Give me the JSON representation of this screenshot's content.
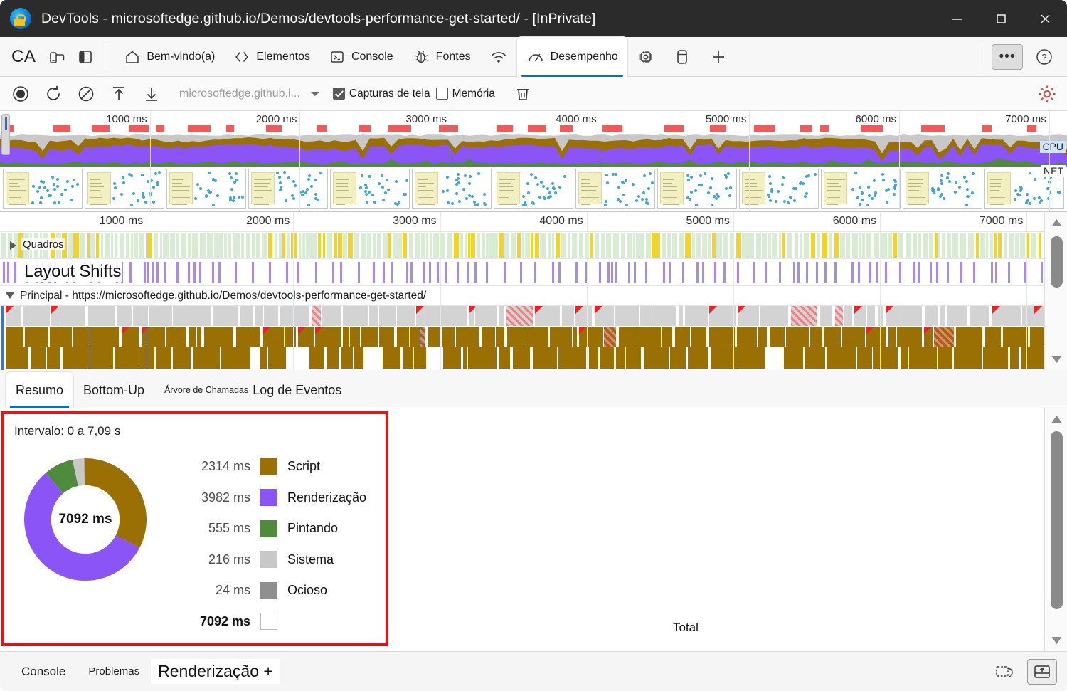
{
  "window": {
    "title": "DevTools - microsoftedge.github.io/Demos/devtools-performance-get-started/ - [InPrivate]",
    "minimize_label": "—",
    "maximize_label": "☐",
    "close_label": "✕"
  },
  "tabstrip": {
    "profile_label": "CA",
    "device_icon": "devices-icon",
    "dock_icon": "dock-side-icon",
    "tabs": [
      {
        "label": "Bem-vindo(a)",
        "icon": "home-icon",
        "selected": false
      },
      {
        "label": "Elementos",
        "icon": "code-brackets-icon",
        "selected": false
      },
      {
        "label": "Console",
        "icon": "console-terminal-icon",
        "selected": false
      },
      {
        "label": "Fontes",
        "icon": "bug-icon",
        "selected": false
      },
      {
        "label": "",
        "icon": "network-wifi-icon",
        "selected": false
      },
      {
        "label": "Desempenho",
        "icon": "gauge-icon",
        "selected": true
      },
      {
        "label": "",
        "icon": "memory-chip-icon",
        "selected": false
      },
      {
        "label": "",
        "icon": "application-storage-icon",
        "selected": false
      },
      {
        "label": "",
        "icon": "plus-icon",
        "selected": false
      }
    ],
    "more_label": "•••",
    "help_label": "?"
  },
  "perf_toolbar": {
    "record_icon": "record-circle-icon",
    "reload_icon": "reload-record-icon",
    "clear_icon": "clear-prohibited-icon",
    "load_icon": "upload-profile-icon",
    "save_icon": "download-profile-icon",
    "url": "microsoftedge.github.i...",
    "dropdown_icon": "chevron-down-icon",
    "screenshots": {
      "label": "Capturas de tela",
      "checked": true
    },
    "memory": {
      "label": "Memória",
      "checked": false
    },
    "delete_icon": "trash-icon",
    "settings_icon": "settings-gear-icon",
    "settings_color": "#e23d3d"
  },
  "overview": {
    "ticks": [
      "1000 ms",
      "2000 ms",
      "3000 ms",
      "4000 ms",
      "5000 ms",
      "6000 ms",
      "7000 ms"
    ],
    "cpu_badge": "CPU",
    "net_badge": "NET",
    "cpu_badge_bg": "#cfe3fb",
    "colors": {
      "scripting": "#9a7004",
      "rendering": "#8b54f7",
      "painting": "#4f8a3d",
      "system": "#c8c8c8",
      "network_mark": "#f05a5a"
    }
  },
  "tracks": {
    "ticks": [
      "1000 ms",
      "2000 ms",
      "3000 ms",
      "4000 ms",
      "5000 ms",
      "6000 ms",
      "7000 ms"
    ],
    "frames_label": "Quadros",
    "layout_shifts_label": "Layout Shifts",
    "main_label": "Principal - https://microsoftedge.github.io/Demos/devtools-performance-get-started/"
  },
  "bottom_tabs": [
    {
      "label": "Resumo",
      "selected": true,
      "small": false
    },
    {
      "label": "Bottom-Up",
      "selected": false,
      "small": false
    },
    {
      "label": "Árvore de Chamadas",
      "selected": false,
      "small": true
    },
    {
      "label": "Log de Eventos",
      "selected": false,
      "small": false
    }
  ],
  "summary": {
    "range_label": "Intervalo: 0 a 7,09 s",
    "total_center": "7092 ms",
    "total_right_label": "Total",
    "highlight_color": "#ee1111",
    "rows": [
      {
        "value": "2314 ms",
        "label": "Script",
        "color": "#9a7004",
        "ms": 2314,
        "total": false
      },
      {
        "value": "3982 ms",
        "label": "Renderização",
        "color": "#8b54f7",
        "ms": 3982,
        "total": false
      },
      {
        "value": "555 ms",
        "label": "Pintando",
        "color": "#4f8a3d",
        "ms": 555,
        "total": false
      },
      {
        "value": "216 ms",
        "label": "Sistema",
        "color": "#c8c8c8",
        "ms": 216,
        "total": false
      },
      {
        "value": "24 ms",
        "label": "Ocioso",
        "color": "#8f8f8f",
        "ms": 24,
        "total": false
      },
      {
        "value": "7092 ms",
        "label": "",
        "color": "#ffffff",
        "ms": 0,
        "total": true
      }
    ]
  },
  "chart_data": {
    "type": "pie",
    "title": "Intervalo: 0 a 7,09 s",
    "categories": [
      "Script",
      "Renderização",
      "Pintando",
      "Sistema",
      "Ocioso"
    ],
    "values": [
      2314,
      3982,
      555,
      216,
      24
    ],
    "unit": "ms",
    "total": 7092,
    "center_label": "7092 ms",
    "colors": [
      "#9a7004",
      "#8b54f7",
      "#4f8a3d",
      "#c8c8c8",
      "#8f8f8f"
    ],
    "legend_position": "right",
    "donut": true,
    "inner_radius_ratio": 0.56
  },
  "statusbar": {
    "items": [
      {
        "label": "Console",
        "highlight": false,
        "small": false
      },
      {
        "label": "Problemas",
        "highlight": false,
        "small": true
      },
      {
        "label": "Renderização +",
        "highlight": true,
        "small": false
      }
    ],
    "dock_icon": "undock-restore-icon",
    "drawer_icon": "drawer-toggle-icon"
  }
}
